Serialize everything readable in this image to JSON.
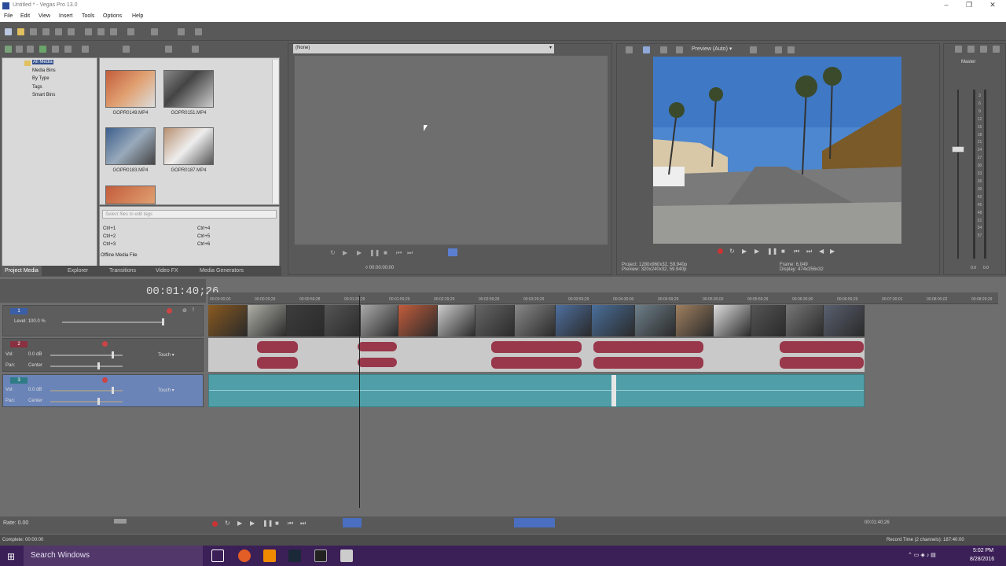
{
  "window": {
    "title": "Untitled * - Vegas Pro 13.0"
  },
  "menu": [
    "File",
    "Edit",
    "View",
    "Insert",
    "Tools",
    "Options",
    "Help"
  ],
  "explorer": {
    "tree": [
      "All Media",
      "Media Bins",
      "By Type",
      "Tags",
      "Smart Bins"
    ],
    "files": [
      "GOPR0149.MP4",
      "GOPR0151.MP4",
      "GOPR0183.MP4",
      "GOPR0187.MP4"
    ],
    "tag_placeholder": "Select files to edit tags",
    "shortcuts": [
      "Ctrl+1",
      "Ctrl+2",
      "Ctrl+3",
      "Ctrl+4",
      "Ctrl+5",
      "Ctrl+6"
    ],
    "offline_label": "Offline Media File"
  },
  "tabs": [
    "Project Media",
    "Explorer",
    "Transitions",
    "Video FX",
    "Media Generators"
  ],
  "trimmer": {
    "selector": "(None)",
    "timecode": "00:00:00;00"
  },
  "preview": {
    "mode": "Preview (Auto)",
    "project_label": "Project:",
    "project_value": "1280x960x32, 59.940p",
    "preview_label": "Preview:",
    "preview_value": "320x240x32, 59.940p",
    "frame_label": "Frame:",
    "frame_value": "6,049",
    "display_label": "Display:",
    "display_value": "474x356x32"
  },
  "master": {
    "label": "Master",
    "scale": [
      "3",
      "6",
      "9",
      "12",
      "15",
      "18",
      "21",
      "24",
      "27",
      "30",
      "33",
      "36",
      "39",
      "42",
      "45",
      "48",
      "51",
      "54",
      "57"
    ],
    "readouts": [
      "0.0",
      "0.0"
    ]
  },
  "timeline": {
    "timecode": "00:01:40;26",
    "ruler": [
      "00:00:00;00",
      "00:00:29;29",
      "00:00:59;28",
      "00:01:29;29",
      "00:01:59;29",
      "00:02:29;29",
      "00:02:59;29",
      "00:03:29;29",
      "00:03:59;29",
      "00:04:30;00",
      "00:04:59;29",
      "00:05:30;00",
      "00:05:59;29",
      "00:06:30;00",
      "00:06:59;29",
      "00:07:30;01",
      "00:08:00;02",
      "00:08:29;29"
    ],
    "tracks": [
      {
        "num": "1",
        "level_label": "Level:",
        "level_value": "100.0 %"
      },
      {
        "num": "2",
        "vol_label": "Vol:",
        "vol_value": "0.0 dB",
        "pan_label": "Pan:",
        "pan_value": "Center",
        "mode": "Touch"
      },
      {
        "num": "3",
        "vol_label": "Vol:",
        "vol_value": "0.0 dB",
        "pan_label": "Pan:",
        "pan_value": "Center",
        "mode": "Touch"
      }
    ],
    "rate_label": "Rate: 0.00",
    "bottom_timecode": "00:01:40;26"
  },
  "status": {
    "left": "Complete: 00:00:00",
    "right": "Record Time (2 channels): 187:40:00"
  },
  "taskbar": {
    "search": "Search Windows",
    "time": "5:02 PM",
    "date": "8/28/2016"
  }
}
